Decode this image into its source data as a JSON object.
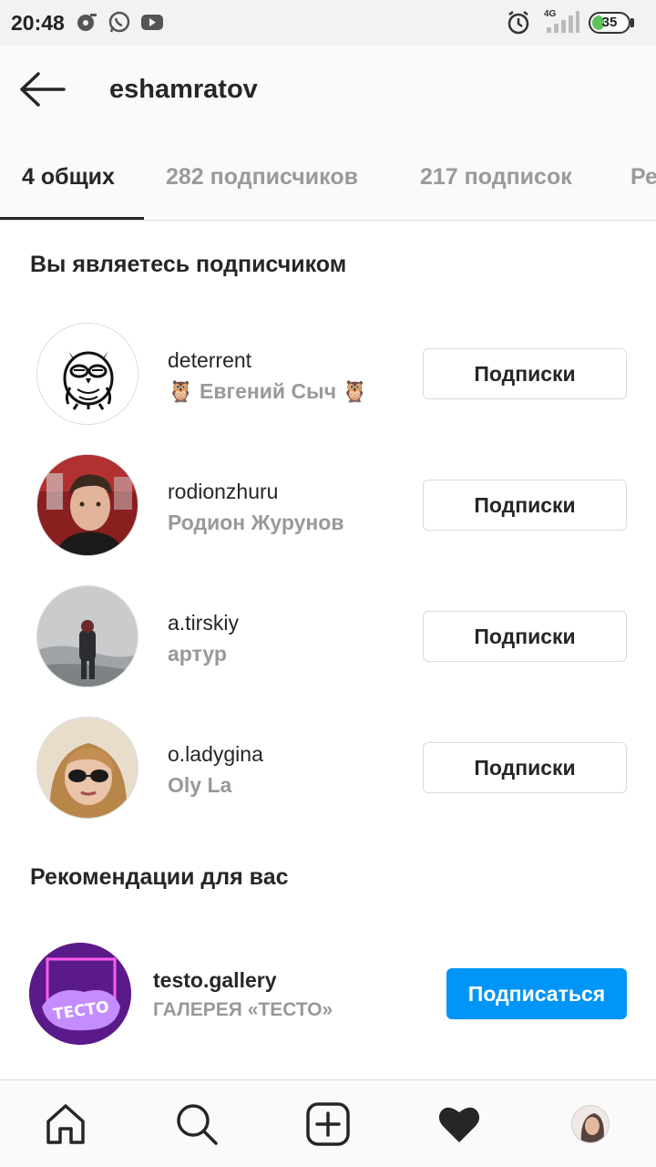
{
  "status_bar": {
    "time": "20:48",
    "network": "4G",
    "battery": "35",
    "battery_level": 0.35,
    "icons": [
      "media-icon",
      "whatsapp-icon",
      "youtube-icon",
      "alarm-icon",
      "signal-icon",
      "battery-icon"
    ]
  },
  "header": {
    "back_icon": "arrow-left-icon",
    "title": "eshamratov"
  },
  "tabs": [
    {
      "label": "4 общих",
      "active": true
    },
    {
      "label": "282 подписчиков",
      "active": false
    },
    {
      "label": "217 подписок",
      "active": false
    },
    {
      "label": "Ре",
      "active": false
    }
  ],
  "following_section": {
    "title": "Вы являетесь подписчиком",
    "users": [
      {
        "username": "deterrent",
        "full_name": "🦉 Евгений Сыч 🦉",
        "button": "Подписки"
      },
      {
        "username": "rodionzhuru",
        "full_name": "Родион Журунов",
        "button": "Подписки"
      },
      {
        "username": "a.tirskiy",
        "full_name": "артур",
        "button": "Подписки"
      },
      {
        "username": "o.ladygina",
        "full_name": "Oly La",
        "button": "Подписки"
      }
    ]
  },
  "recommendations": {
    "title": "Рекомендации для вас",
    "users": [
      {
        "username": "testo.gallery",
        "full_name": "ГАЛЕРЕЯ «ТЕСТО»",
        "avatar_text": "ТЕСТО",
        "button": "Подписаться"
      }
    ]
  },
  "bottom_nav": [
    {
      "name": "home-icon"
    },
    {
      "name": "search-icon"
    },
    {
      "name": "add-post-icon"
    },
    {
      "name": "heart-icon"
    },
    {
      "name": "profile-avatar"
    }
  ],
  "colors": {
    "primary": "#0095f6",
    "text": "#262626",
    "secondary_text": "#999999",
    "border": "#dbdbdb"
  }
}
